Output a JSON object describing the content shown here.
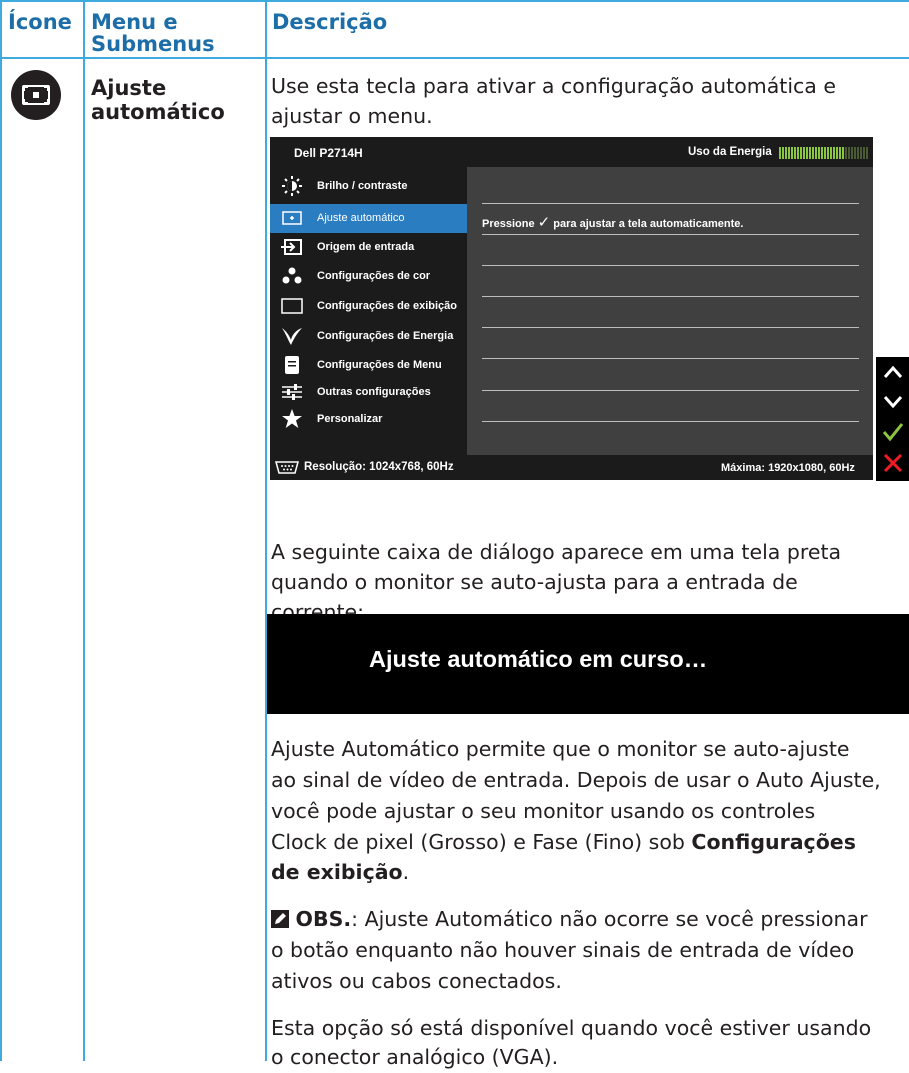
{
  "table": {
    "headers": {
      "icon": "Ícone",
      "menu": "Menu e\nSubmenus",
      "desc": "Descrição"
    },
    "row": {
      "menu_line1": "Ajuste",
      "menu_line2": "automático",
      "intro_line1": "Use esta tecla para ativar a configuração automática e",
      "intro_line2": "ajustar o menu."
    }
  },
  "osd": {
    "model": "Dell P2714H",
    "energy_label": "Uso da Energia",
    "energy_level": 0.72,
    "menu_items": [
      {
        "label": "Brilho / contraste",
        "icon": "brightness-icon"
      },
      {
        "label": "Ajuste automático",
        "icon": "auto-adjust-icon",
        "selected": true
      },
      {
        "label": "Origem de entrada",
        "icon": "input-source-icon"
      },
      {
        "label": "Configurações de cor",
        "icon": "color-dots-icon"
      },
      {
        "label": "Configurações de exibição",
        "icon": "display-rect-icon"
      },
      {
        "label": "Configurações de Energia",
        "icon": "energy-leaf-icon"
      },
      {
        "label": "Configurações de Menu",
        "icon": "menu-list-icon"
      },
      {
        "label": "Outras configurações",
        "icon": "sliders-icon"
      },
      {
        "label": "Personalizar",
        "icon": "star-icon"
      }
    ],
    "press_prefix": "Pressione",
    "press_suffix": "para ajustar a tela automaticamente.",
    "resolution": "Resolução: 1024x768, 60Hz",
    "max": "Máxima: 1920x1080, 60Hz",
    "controls": [
      "up-arrow-icon",
      "down-arrow-icon",
      "check-icon",
      "close-icon"
    ],
    "colors": {
      "selected": "#2a7dc0",
      "check": "#8cc63f",
      "close": "#ed1c24",
      "bar": "#8cc63f"
    }
  },
  "dialog_paragraph": [
    "A seguinte caixa de diálogo aparece em uma tela preta",
    "quando o monitor se auto-ajusta para a entrada de",
    "corrente:"
  ],
  "black_box_text": "Ajuste automático em curso…",
  "auto_paragraph": {
    "lines": [
      "Ajuste Automático permite que o monitor se auto-ajuste",
      "ao sinal de vídeo de entrada. Depois de usar o Auto Ajuste,",
      "você pode ajustar o seu monitor usando os controles"
    ],
    "line4": "Clock de pixel (Grosso) e Fase (Fino) sob ",
    "bold1": "Configurações",
    "bold2": "de exibição",
    "end": "."
  },
  "note": {
    "label": "OBS.",
    "line1_rest": ": Ajuste Automático não ocorre se você pressionar",
    "line2": "o botão enquanto não houver sinais de entrada de vídeo",
    "line3": "ativos ou cabos conectados."
  },
  "vga_paragraph": [
    "Esta opção só está disponível quando você estiver usando",
    "o conector analógico (VGA)."
  ]
}
